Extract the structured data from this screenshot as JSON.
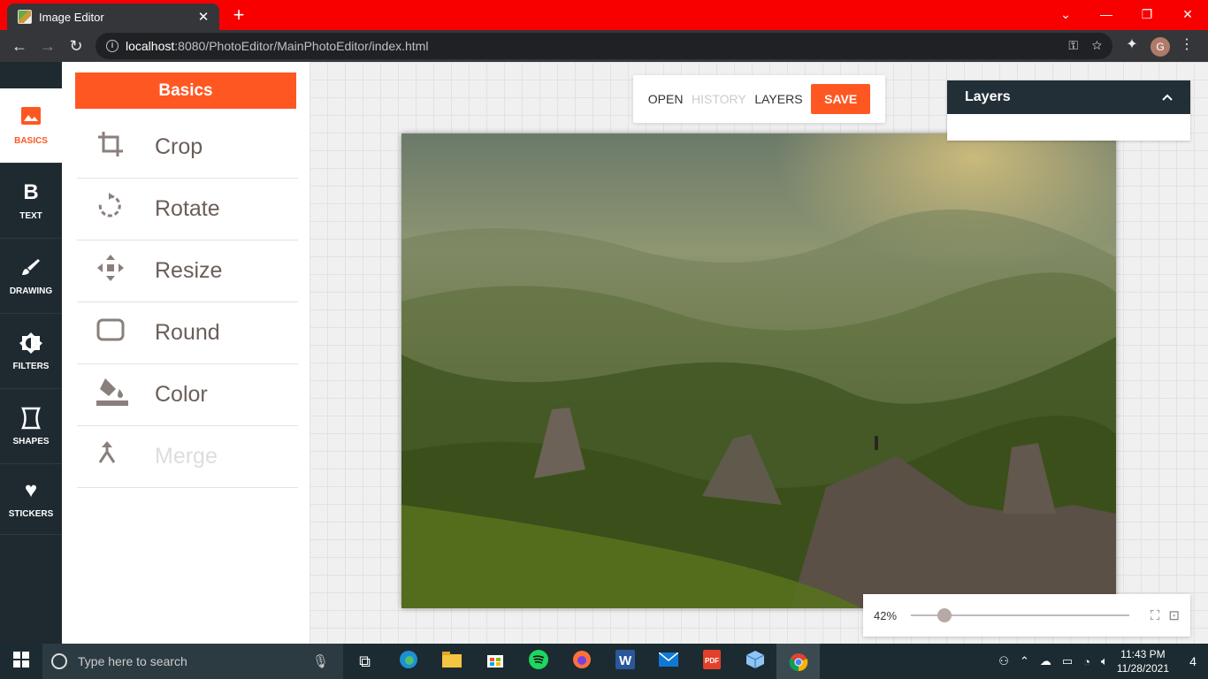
{
  "browser": {
    "tab_title": "Image Editor",
    "tab_close": "✕",
    "new_tab": "+",
    "url_host": "localhost",
    "url_rest": ":8080/PhotoEditor/MainPhotoEditor/index.html",
    "avatar_letter": "G"
  },
  "rail": {
    "items": [
      {
        "label": "BASICS",
        "icon": "image-icon"
      },
      {
        "label": "TEXT",
        "icon": "bold-b-icon"
      },
      {
        "label": "DRAWING",
        "icon": "brush-icon"
      },
      {
        "label": "FILTERS",
        "icon": "brightness-icon"
      },
      {
        "label": "SHAPES",
        "icon": "shape-icon"
      },
      {
        "label": "STICKERS",
        "icon": "heart-icon"
      }
    ]
  },
  "panel": {
    "title": "Basics",
    "items": [
      {
        "label": "Crop",
        "icon": "crop-icon"
      },
      {
        "label": "Rotate",
        "icon": "rotate-icon"
      },
      {
        "label": "Resize",
        "icon": "move-icon"
      },
      {
        "label": "Round",
        "icon": "rounded-rect-icon"
      },
      {
        "label": "Color",
        "icon": "paint-bucket-icon"
      },
      {
        "label": "Merge",
        "icon": "merge-icon"
      }
    ]
  },
  "topbar": {
    "open": "OPEN",
    "history": "HISTORY",
    "layers": "LAYERS",
    "save": "SAVE"
  },
  "layers_panel": {
    "title": "Layers"
  },
  "zoom": {
    "value_label": "42%",
    "level": 0.12
  },
  "taskbar": {
    "search_placeholder": "Type here to search",
    "time": "11:43 PM",
    "date": "11/28/2021",
    "notification_count": "4"
  },
  "colors": {
    "accent": "#ff5722",
    "rail_bg": "#1f2a30",
    "titlebar": "#f90000"
  }
}
